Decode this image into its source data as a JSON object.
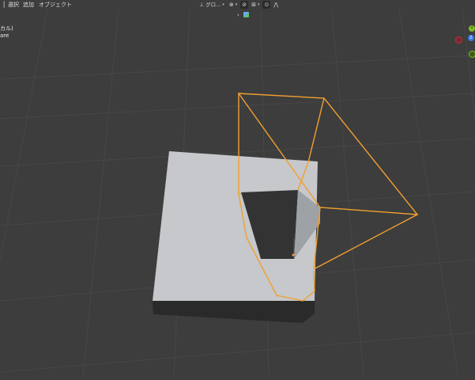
{
  "menu": [
    "選択",
    "追加",
    "オブジェクト"
  ],
  "header": {
    "transform_orientation": "グロ...",
    "view_info_line1": "カル)",
    "view_info_line2": "are"
  },
  "gizmo": {
    "y_label": "Y",
    "z_label": "Z"
  },
  "colors": {
    "background": "#3d3d3d",
    "grid": "#4a4a4a",
    "selection": "#f0a030",
    "face_light": "#c7c9cc",
    "face_shadow": "#2a2a2a",
    "x_axis": "#c8323e",
    "y_axis": "#7fbf20",
    "z_axis": "#3a78e0"
  },
  "icons": {
    "header_menu_toggle": "menu-icon",
    "transform_orientation": "orientation-icon",
    "pivot": "pivot-icon",
    "snap": "snap-magnet-icon",
    "snap_target": "grid-snap-icon",
    "proportional": "proportional-edit-icon",
    "falloff": "falloff-curve-icon",
    "collapse": "chevron-right-icon",
    "viewport_shading": "cube-icon"
  }
}
